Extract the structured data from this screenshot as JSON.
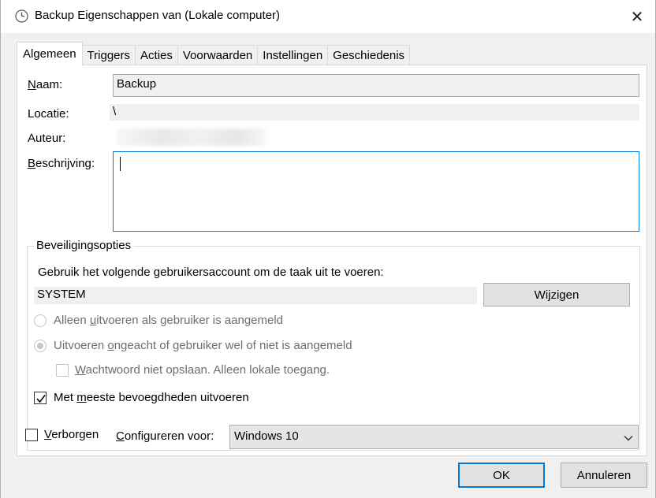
{
  "window": {
    "title": "Backup Eigenschappen van (Lokale computer)",
    "icon": "clock-icon",
    "close_glyph": "✕"
  },
  "tabs": [
    "Algemeen",
    "Triggers",
    "Acties",
    "Voorwaarden",
    "Instellingen",
    "Geschiedenis"
  ],
  "general": {
    "name_label_u": "N",
    "name_label_rest": "aam:",
    "name_value": "Backup",
    "location_label": "Locatie:",
    "location_value": "\\",
    "author_label": "Auteur:",
    "description_label_u": "B",
    "description_label_rest": "eschrijving:",
    "description_value": ""
  },
  "security": {
    "group_title": "Beveiligingsopties",
    "account_prompt": "Gebruik het volgende gebruikersaccount om de taak uit te voeren:",
    "account_value": "SYSTEM",
    "change_button": "Wijzigen",
    "radio1_pre": "Alleen ",
    "radio1_u": "u",
    "radio1_post": "itvoeren als gebruiker is aangemeld",
    "radio2_pre": "Uitvoeren ",
    "radio2_u": "o",
    "radio2_post": "ngeacht of gebruiker wel of niet is aangemeld",
    "nopass_u": "W",
    "nopass_post": "achtwoord niet opslaan. Alleen lokale toegang.",
    "highest_pre": "Met ",
    "highest_u": "m",
    "highest_post": "eeste bevoegdheden uitvoeren",
    "radio1_checked": false,
    "radio2_checked": true,
    "nopass_checked": false,
    "highest_checked": true
  },
  "bottom": {
    "hidden_u": "V",
    "hidden_post": "erborgen",
    "hidden_checked": false,
    "configure_u": "C",
    "configure_post": "onfigureren voor:",
    "configure_value": "Windows 10"
  },
  "buttons": {
    "ok": "OK",
    "cancel": "Annuleren"
  },
  "colors": {
    "accent": "#0078d7",
    "disabled": "#6d6d6d"
  }
}
